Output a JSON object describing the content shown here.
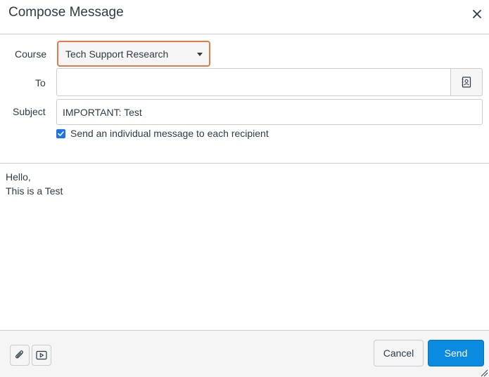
{
  "dialog": {
    "title": "Compose Message",
    "close_icon": "close-icon"
  },
  "form": {
    "course": {
      "label": "Course",
      "selected": "Tech Support Research",
      "focus_color": "#e07a4a"
    },
    "to": {
      "label": "To",
      "value": "",
      "address_book_icon": "address-book-icon"
    },
    "subject": {
      "label": "Subject",
      "value": "IMPORTANT: Test"
    },
    "individual_message": {
      "label": "Send an individual message to each recipient",
      "checked": true
    }
  },
  "message_body": {
    "lines": [
      "Hello,",
      "This is a Test"
    ]
  },
  "footer": {
    "attach_icon": "paperclip-icon",
    "media_icon": "media-icon",
    "cancel_label": "Cancel",
    "send_label": "Send",
    "send_color": "#0a8be0"
  }
}
